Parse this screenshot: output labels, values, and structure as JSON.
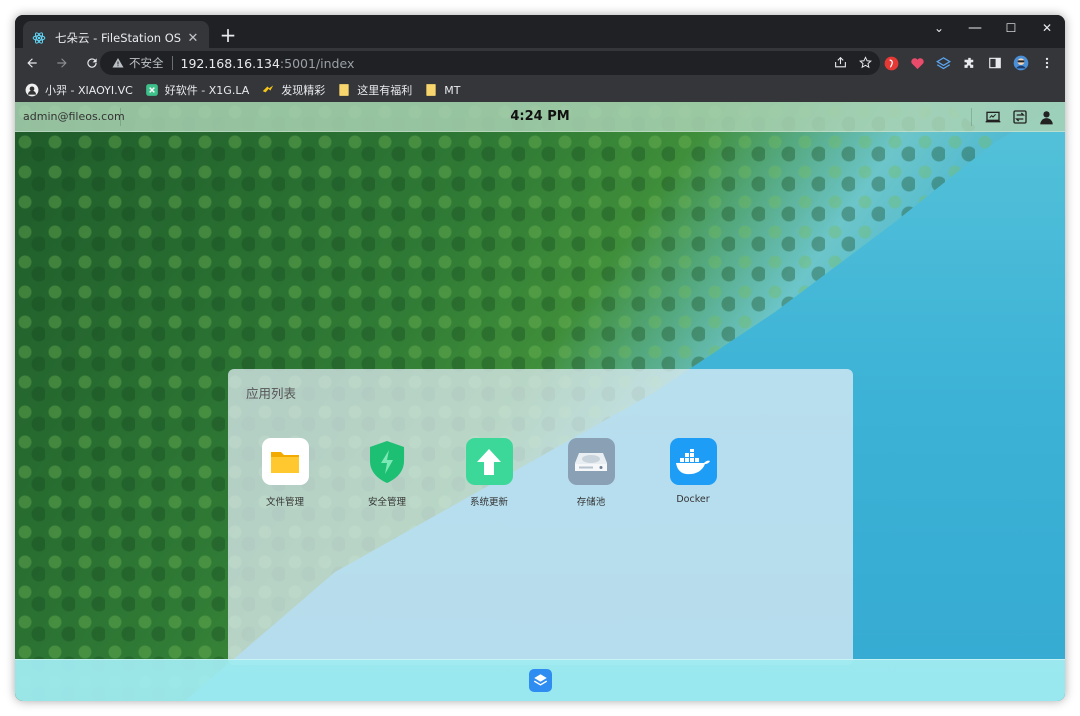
{
  "browser": {
    "tab": {
      "title": "七朵云 - FileStation OS",
      "close_label": "✕"
    },
    "new_tab_label": "+",
    "window_controls": {
      "collapse": "⌄",
      "minimize": "—",
      "maximize": "☐",
      "close": "✕"
    },
    "omnibox": {
      "security_text": "不安全",
      "host": "192.168.16.134",
      "path": ":5001/index"
    },
    "bookmarks": [
      {
        "label": "小羿 - XIAOYI.VC",
        "icon": "avatar-icon"
      },
      {
        "label": "好软件 - X1G.LA",
        "icon": "app-icon"
      },
      {
        "label": "发现精彩",
        "icon": "arrow-icon"
      },
      {
        "label": "这里有福利",
        "icon": "folder-icon"
      },
      {
        "label": "MT",
        "icon": "folder-icon"
      }
    ]
  },
  "os": {
    "user": "admin@fileos.com",
    "clock": "4:24 PM",
    "panel_title": "应用列表",
    "apps": [
      {
        "label": "文件管理",
        "icon": "folder-icon",
        "color": "#ffffff"
      },
      {
        "label": "安全管理",
        "icon": "shield-icon",
        "color": "#1dbf73"
      },
      {
        "label": "系统更新",
        "icon": "upload-arrow-icon",
        "color": "#3cd89a"
      },
      {
        "label": "存储池",
        "icon": "hard-drive-icon",
        "color": "#8aa0b4"
      },
      {
        "label": "Docker",
        "icon": "docker-icon",
        "color": "#1d9df5"
      }
    ]
  },
  "colors": {
    "chrome_dark": "#202124",
    "chrome_toolbar": "#35363a",
    "dock_accent": "#2f8cf0"
  }
}
